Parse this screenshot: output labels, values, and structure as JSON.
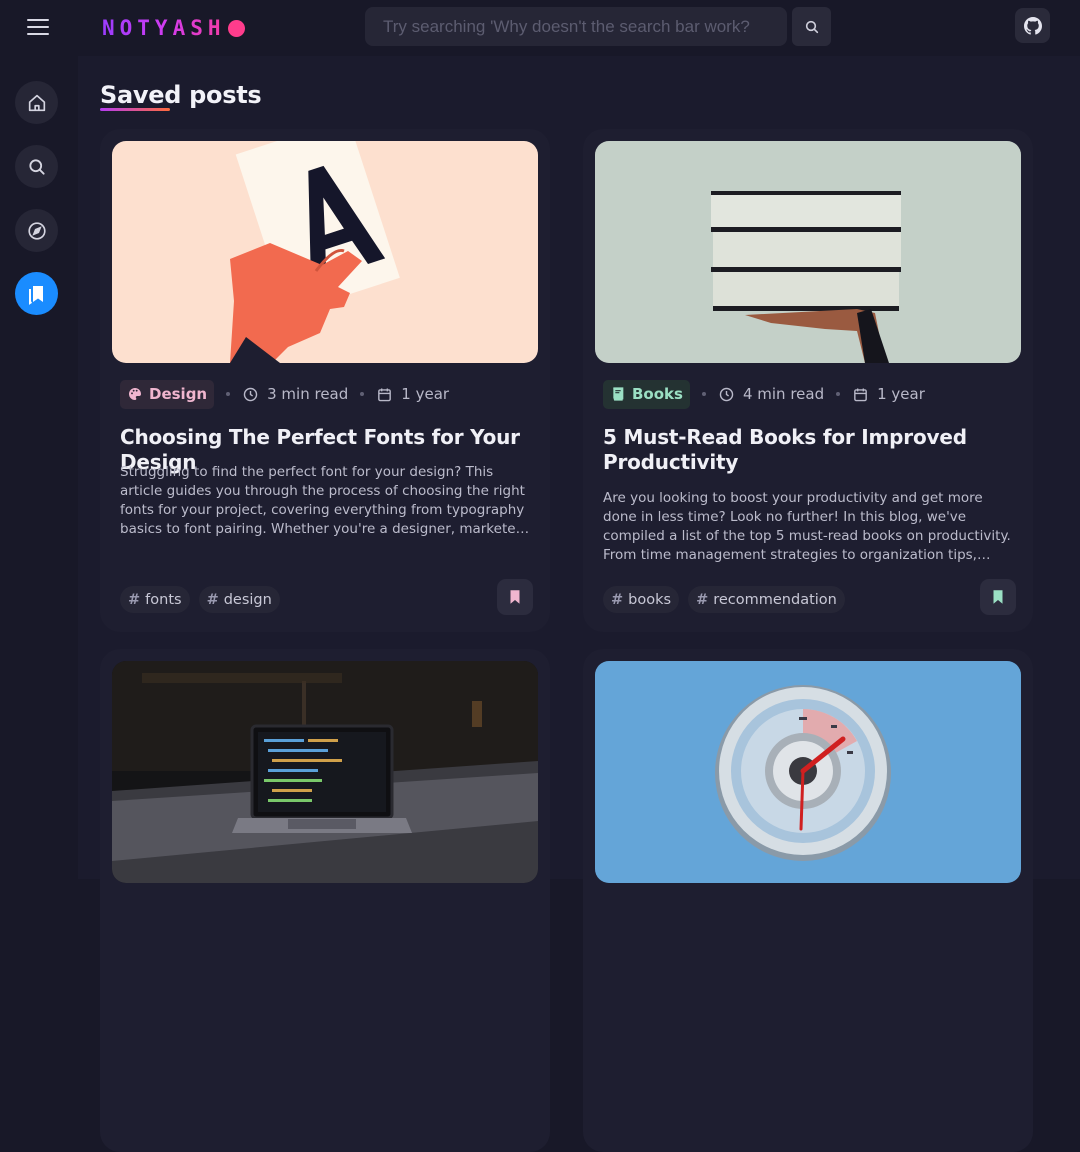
{
  "header": {
    "logo_text": "NOTYASH",
    "search_placeholder": "Try searching 'Why doesn't the search bar work?",
    "menu_icon": "hamburger-menu-icon",
    "search_icon": "search-icon",
    "github_icon": "github-icon"
  },
  "sidebar": {
    "items": [
      {
        "name": "home",
        "icon": "home-icon",
        "active": false
      },
      {
        "name": "search",
        "icon": "search-icon",
        "active": false
      },
      {
        "name": "explore",
        "icon": "compass-icon",
        "active": false
      },
      {
        "name": "saved",
        "icon": "bookmarks-icon",
        "active": true
      }
    ]
  },
  "page": {
    "title": "Saved posts"
  },
  "posts": [
    {
      "category": "Design",
      "category_icon": "palette-icon",
      "read_time": "3 min read",
      "age": "1 year",
      "title": "Choosing The Perfect Fonts for Your Design",
      "description": "Struggling to find the perfect font for your design? This article guides you through the process of choosing the right fonts for your project, covering everything from typography basics to font pairing. Whether you're a designer, marketer, or simply looking to improve...",
      "tags": [
        "fonts",
        "design"
      ],
      "image": "hand-holding-letter-a-card"
    },
    {
      "category": "Books",
      "category_icon": "book-icon",
      "read_time": "4 min read",
      "age": "1 year",
      "title": "5 Must-Read Books for Improved Productivity",
      "description": "Are you looking to boost your productivity and get more done in less time? Look no further! In this blog, we've compiled a list of the top 5 must-read books on productivity. From time management strategies to organization tips, these books are packed with...",
      "tags": [
        "books",
        "recommendation"
      ],
      "image": "hand-holding-stack-of-books"
    },
    {
      "image": "laptop-on-desk-at-night"
    },
    {
      "image": "blue-clock-dial"
    }
  ],
  "colors": {
    "accent": "#1a8cff",
    "background": "#181828",
    "card": "#1e1e30",
    "design_badge": "#f0b6cf",
    "books_badge": "#9be0c4"
  }
}
